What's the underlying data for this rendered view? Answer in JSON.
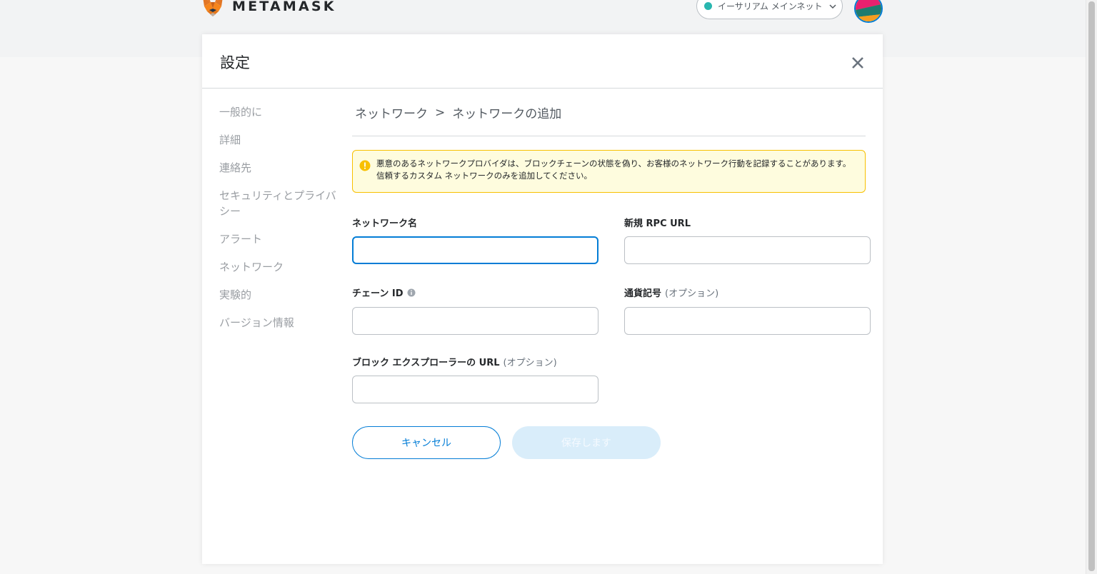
{
  "app": {
    "name": "METAMASK"
  },
  "network": {
    "current": "イーサリアム メインネット",
    "dot_color": "#29b6af"
  },
  "settings": {
    "title": "設定",
    "sidebar": [
      "一般的に",
      "詳細",
      "連絡先",
      "セキュリティとプライバシー",
      "アラート",
      "ネットワーク",
      "実験的",
      "バージョン情報"
    ]
  },
  "breadcrumb": {
    "parent": "ネットワーク",
    "separator": ">",
    "current": "ネットワークの追加"
  },
  "warning": {
    "text": "悪意のあるネットワークプロバイダは、ブロックチェーンの状態を偽り、お客様のネットワーク行動を記録することがあります。 信頼するカスタム ネットワークのみを追加してください。",
    "border_color": "#f8c000",
    "background": "#fefcde"
  },
  "form": {
    "network_name": {
      "label": "ネットワーク名",
      "value": ""
    },
    "rpc_url": {
      "label": "新規 RPC URL",
      "value": ""
    },
    "chain_id": {
      "label": "チェーン ID",
      "value": ""
    },
    "currency_symbol": {
      "label": "通貨記号",
      "optional": "(オプション)",
      "value": ""
    },
    "explorer_url": {
      "label": "ブロック エクスプローラーの URL",
      "optional": "(オプション)",
      "value": ""
    }
  },
  "buttons": {
    "cancel": "キャンセル",
    "save": "保存します"
  },
  "colors": {
    "primary": "#037dd6",
    "save_disabled_bg": "#d9edfa"
  }
}
